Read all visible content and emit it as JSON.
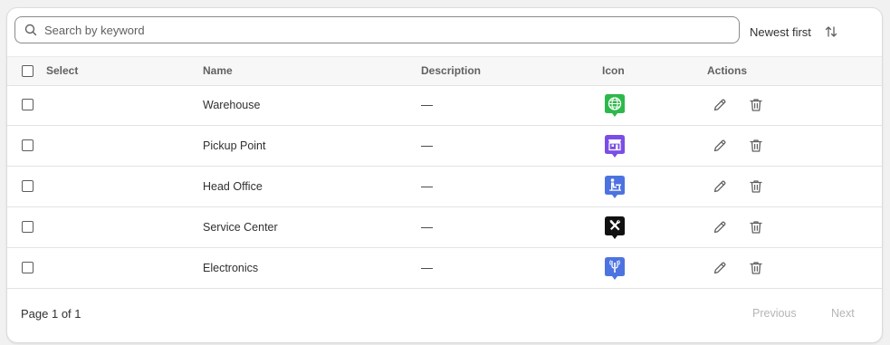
{
  "search": {
    "placeholder": "Search by keyword",
    "value": ""
  },
  "sort": {
    "label": "Newest first",
    "icon": "sort-arrows-icon"
  },
  "columns": {
    "select": "Select",
    "name": "Name",
    "description": "Description",
    "icon": "Icon",
    "actions": "Actions"
  },
  "rows": [
    {
      "name": "Warehouse",
      "description": "—",
      "icon": "globe-icon",
      "color": "#2eb84b"
    },
    {
      "name": "Pickup Point",
      "description": "—",
      "icon": "store-icon",
      "color": "#7a4ee6"
    },
    {
      "name": "Head Office",
      "description": "—",
      "icon": "person-at-desk-icon",
      "color": "#4d73e0"
    },
    {
      "name": "Service Center",
      "description": "—",
      "icon": "wrench-screwdriver-icon",
      "color": "#111111"
    },
    {
      "name": "Electronics",
      "description": "—",
      "icon": "antenna-icon",
      "color": "#4d73e0"
    }
  ],
  "actions": {
    "edit_icon": "pencil-icon",
    "delete_icon": "trash-icon"
  },
  "pagination": {
    "info": "Page 1 of 1",
    "previous": "Previous",
    "next": "Next"
  }
}
